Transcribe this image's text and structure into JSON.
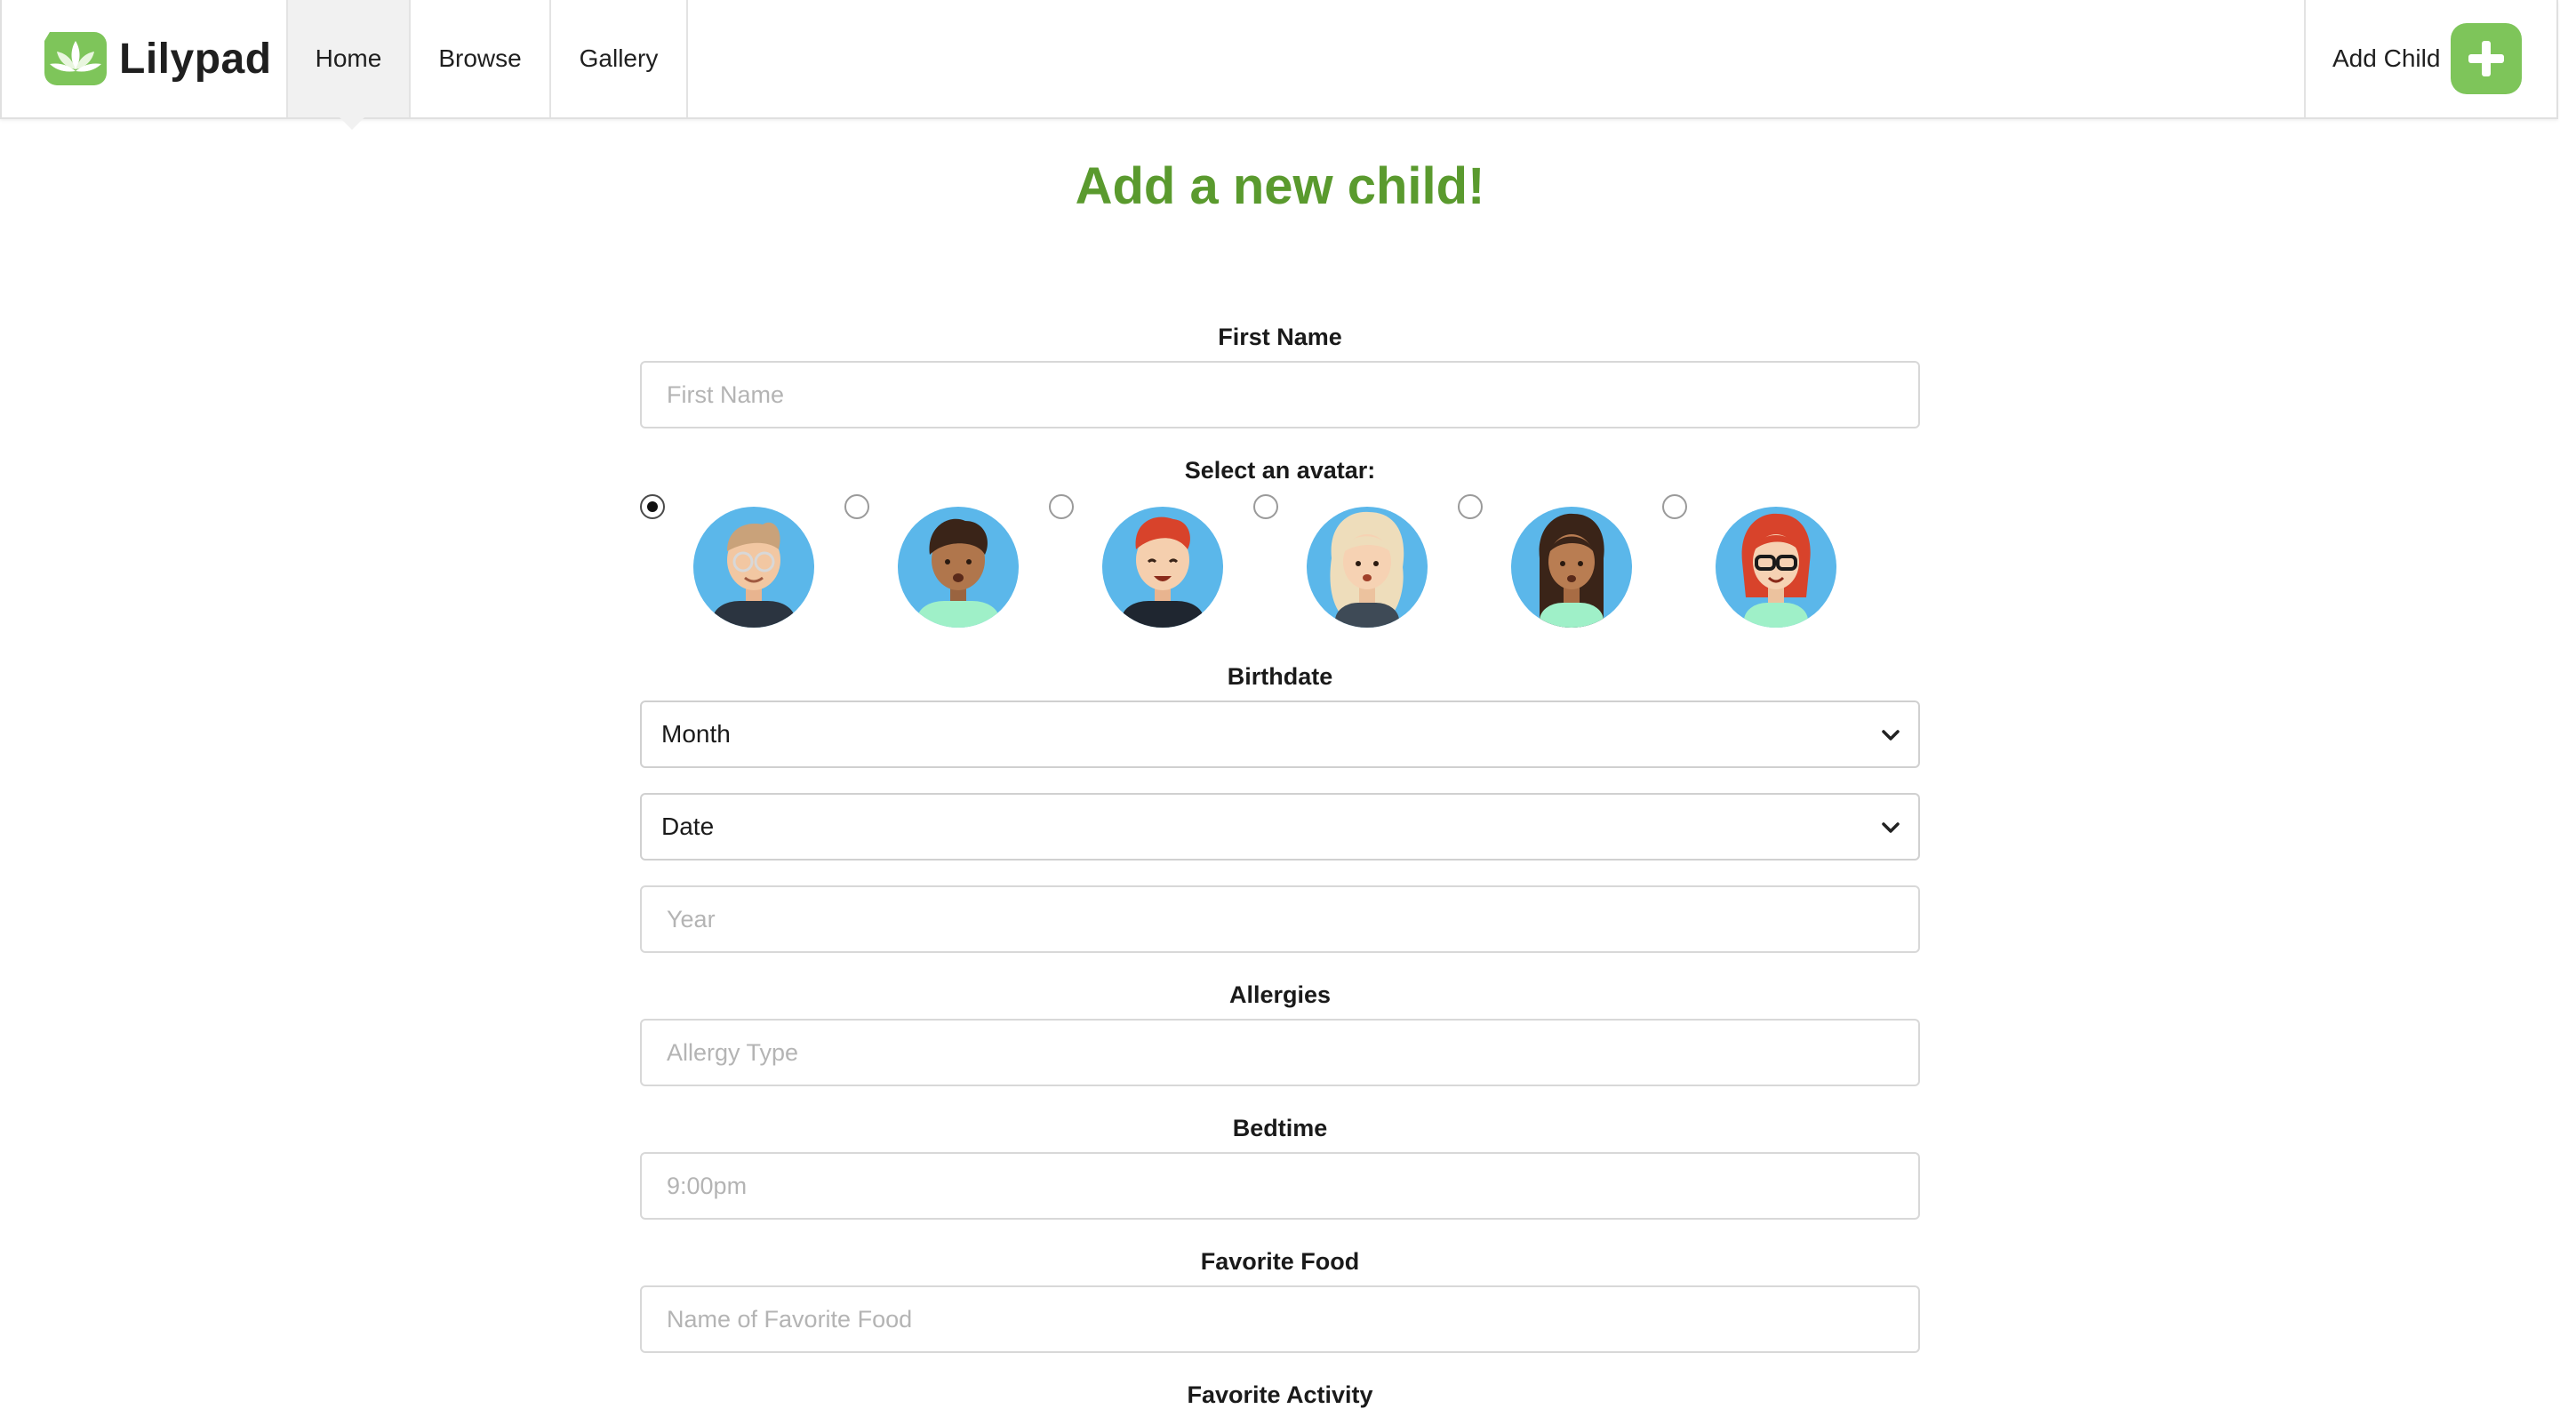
{
  "brand": {
    "name": "Lilypad"
  },
  "nav": {
    "tabs": [
      {
        "label": "Home"
      },
      {
        "label": "Browse"
      },
      {
        "label": "Gallery"
      }
    ],
    "active_tab": "Home",
    "add_child_label": "Add Child"
  },
  "form": {
    "title": "Add a new child!",
    "first_name": {
      "label": "First Name",
      "placeholder": "First Name",
      "value": ""
    },
    "avatar": {
      "label": "Select an avatar:",
      "selected_index": 0,
      "options": [
        "boy-glasses-avatar",
        "boy-curly-avatar",
        "boy-redhead-avatar",
        "girl-blonde-avatar",
        "girl-brunette-avatar",
        "girl-redhead-glasses-avatar"
      ]
    },
    "birthdate": {
      "label": "Birthdate",
      "month_value": "Month",
      "date_value": "Date",
      "year_placeholder": "Year"
    },
    "allergies": {
      "label": "Allergies",
      "placeholder": "Allergy Type"
    },
    "bedtime": {
      "label": "Bedtime",
      "placeholder": "9:00pm"
    },
    "favorite_food": {
      "label": "Favorite Food",
      "placeholder": "Name of Favorite Food"
    },
    "favorite_activity": {
      "label": "Favorite Activity"
    }
  },
  "colors": {
    "brand_green": "#7ec55a",
    "title_green": "#5a9a2e",
    "avatar_bg": "#5bb7ea",
    "nav_active_bg": "#f1f1f1"
  }
}
